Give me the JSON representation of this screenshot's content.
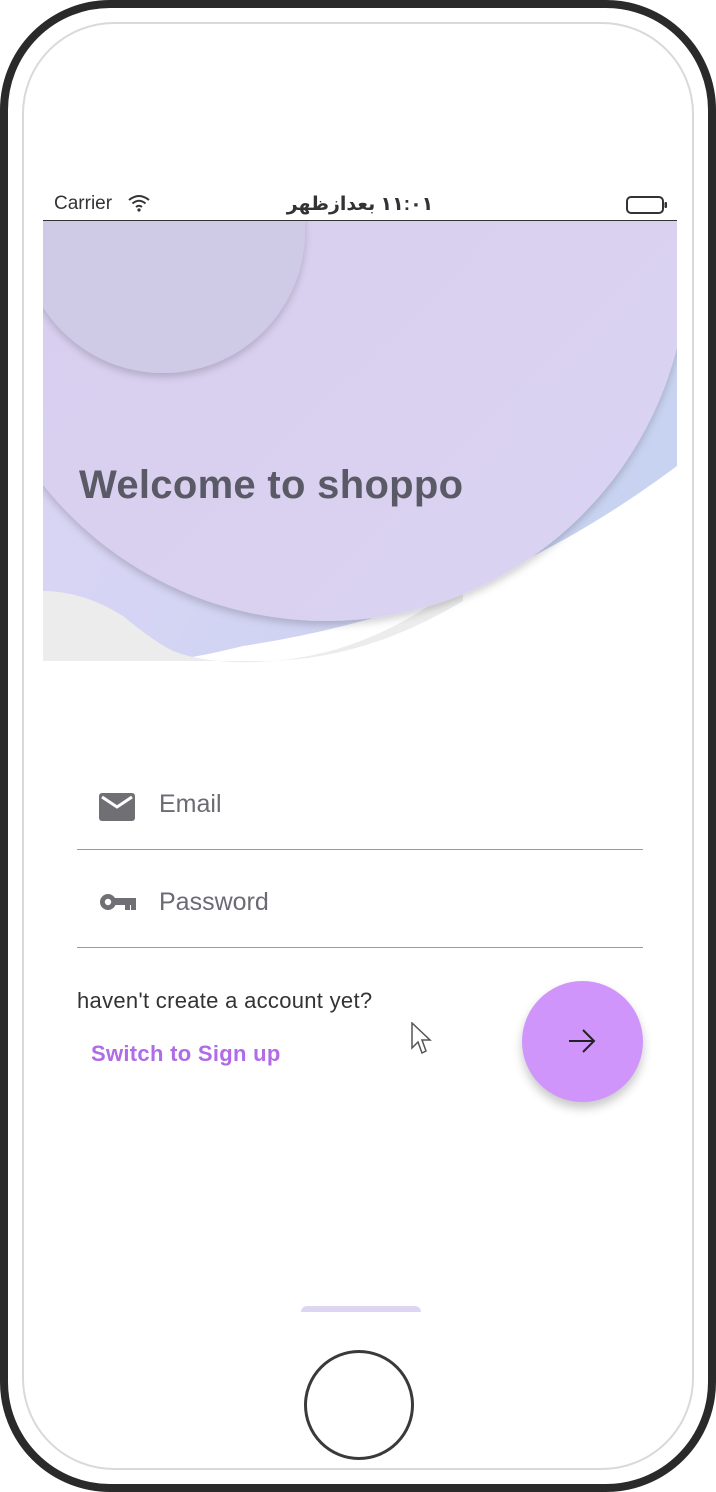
{
  "status_bar": {
    "carrier": "Carrier",
    "time": "١١:٠١ بعدازظهر"
  },
  "header": {
    "title": "Welcome to shoppo"
  },
  "form": {
    "email_placeholder": "Email",
    "password_placeholder": "Password",
    "hint_text": "haven't create a account yet?",
    "switch_link": "Switch to Sign up"
  },
  "icons": {
    "email": "mail-icon",
    "password": "key-icon",
    "submit": "arrow-right-icon",
    "wifi": "wifi-icon",
    "battery": "battery-icon"
  },
  "colors": {
    "accent": "#cf95fb",
    "link": "#b06be6",
    "header_lavender": "#dcd3f4",
    "header_blue": "#c9d2f2"
  }
}
